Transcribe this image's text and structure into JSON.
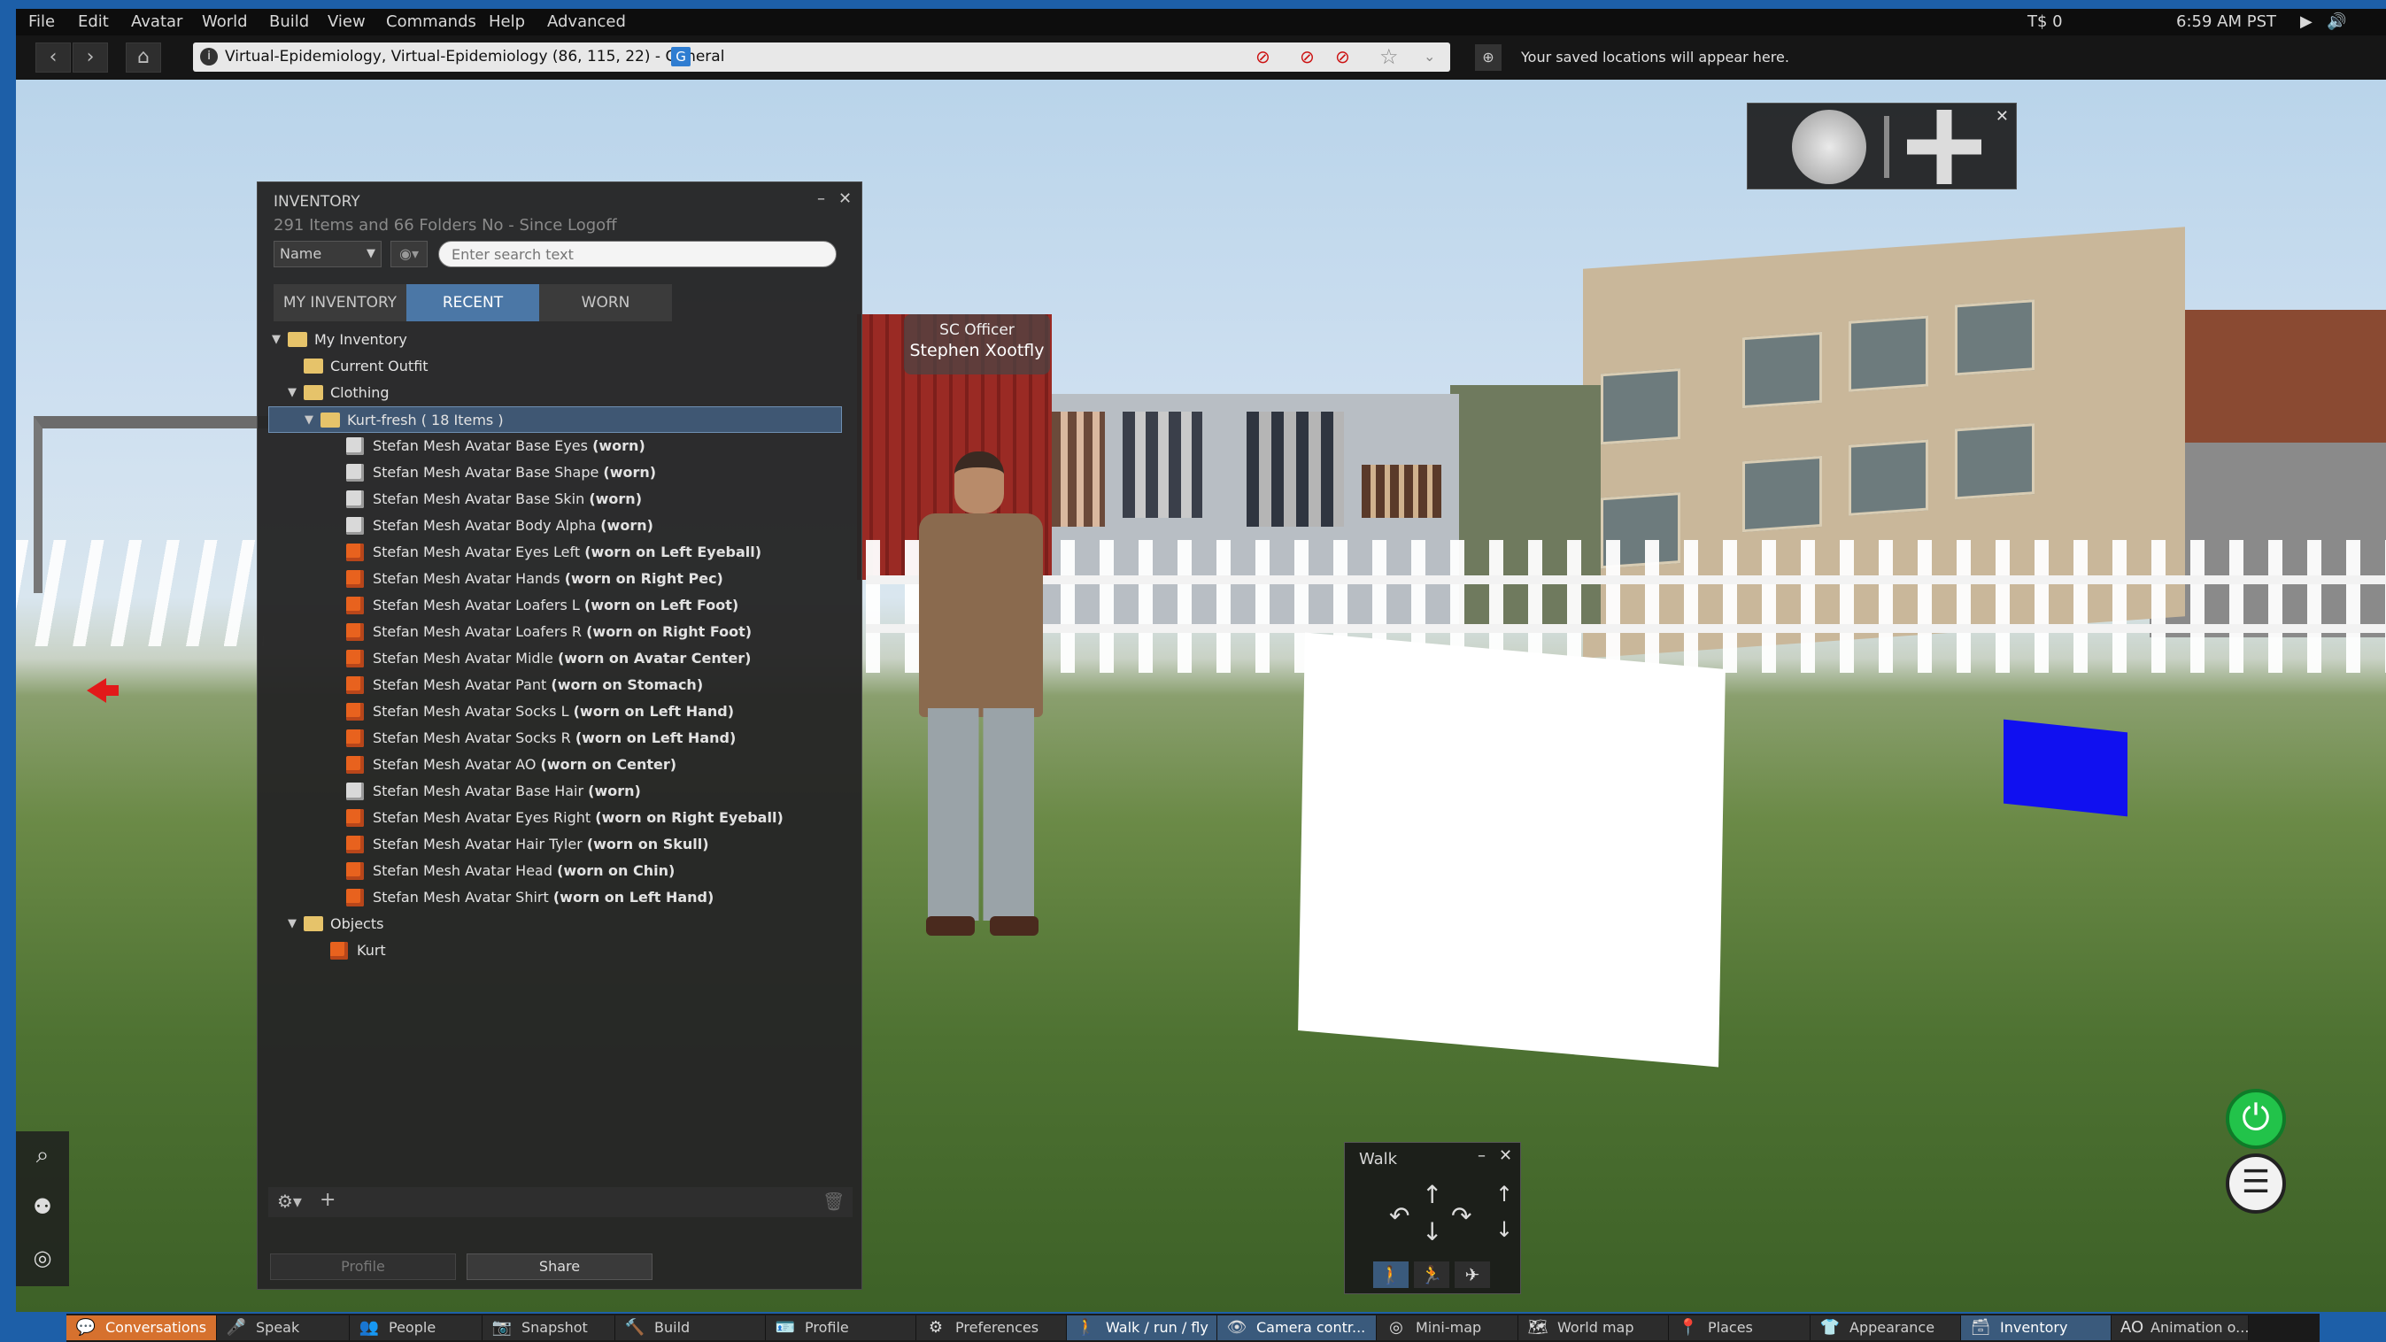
{
  "menu": {
    "items": [
      "File",
      "Edit",
      "Avatar",
      "World",
      "Build",
      "View",
      "Commands",
      "Help",
      "Advanced"
    ],
    "balance": "T$ 0",
    "time": "6:59 AM PST"
  },
  "navbar": {
    "location": "Virtual-Epidemiology, Virtual-Epidemiology (86, 115, 22) - General",
    "maturity_badge": "G",
    "favorites_hint": "Your saved locations will appear here."
  },
  "nametag": {
    "group": "SC Officer",
    "name": "Stephen Xootfly"
  },
  "inventory": {
    "title": "INVENTORY",
    "summary": "291 Items and 66 Folders No  - Since Logoff",
    "sort_select": "Name",
    "search_placeholder": "Enter search text",
    "tabs": [
      "MY INVENTORY",
      "RECENT",
      "WORN"
    ],
    "active_tab": "RECENT",
    "tree": [
      {
        "label": "My Inventory",
        "kind": "folder-open",
        "depth": 0
      },
      {
        "label": "Current Outfit",
        "kind": "folder",
        "depth": 1
      },
      {
        "label": "Clothing",
        "kind": "folder-open",
        "depth": 1
      },
      {
        "label": "Kurt-fresh ( 18 Items )",
        "kind": "folder-open",
        "depth": 2,
        "selected": true
      },
      {
        "label": "Stefan Mesh Avatar Base Eyes",
        "suffix": "(worn)",
        "kind": "eyes",
        "depth": 3
      },
      {
        "label": "Stefan Mesh Avatar Base Shape",
        "suffix": "(worn)",
        "kind": "shape",
        "depth": 3
      },
      {
        "label": "Stefan Mesh Avatar Base Skin",
        "suffix": "(worn)",
        "kind": "skin",
        "depth": 3
      },
      {
        "label": "Stefan Mesh Avatar Body Alpha",
        "suffix": "(worn)",
        "kind": "alpha",
        "depth": 3
      },
      {
        "label": "Stefan Mesh Avatar Eyes Left",
        "suffix": "(worn on Left Eyeball)",
        "kind": "object",
        "depth": 3
      },
      {
        "label": "Stefan Mesh Avatar Hands",
        "suffix": "(worn on Right Pec)",
        "kind": "object",
        "depth": 3
      },
      {
        "label": "Stefan Mesh Avatar Loafers L",
        "suffix": "(worn on Left Foot)",
        "kind": "object",
        "depth": 3
      },
      {
        "label": "Stefan Mesh Avatar Loafers R",
        "suffix": "(worn on Right Foot)",
        "kind": "object",
        "depth": 3
      },
      {
        "label": "Stefan Mesh Avatar Midle",
        "suffix": "(worn on Avatar Center)",
        "kind": "object",
        "depth": 3
      },
      {
        "label": "Stefan Mesh Avatar Pant",
        "suffix": "(worn on Stomach)",
        "kind": "object",
        "depth": 3
      },
      {
        "label": "Stefan Mesh Avatar Socks L",
        "suffix": "(worn on Left Hand)",
        "kind": "object",
        "depth": 3
      },
      {
        "label": "Stefan Mesh Avatar Socks R",
        "suffix": "(worn on Left Hand)",
        "kind": "object",
        "depth": 3
      },
      {
        "label": "Stefan Mesh Avatar AO",
        "suffix": "(worn on Center)",
        "kind": "object",
        "depth": 3
      },
      {
        "label": "Stefan Mesh Avatar Base Hair",
        "suffix": "(worn)",
        "kind": "hair",
        "depth": 3
      },
      {
        "label": "Stefan Mesh Avatar Eyes Right",
        "suffix": "(worn on Right Eyeball)",
        "kind": "object",
        "depth": 3
      },
      {
        "label": "Stefan Mesh Avatar Hair Tyler",
        "suffix": "(worn on Skull)",
        "kind": "object",
        "depth": 3
      },
      {
        "label": "Stefan Mesh Avatar Head",
        "suffix": "(worn on Chin)",
        "kind": "object",
        "depth": 3
      },
      {
        "label": "Stefan Mesh Avatar Shirt",
        "suffix": "(worn on Left Hand)",
        "kind": "object",
        "depth": 3
      },
      {
        "label": "Objects",
        "kind": "folder-open",
        "depth": 1
      },
      {
        "label": "Kurt",
        "kind": "object",
        "depth": 2
      }
    ],
    "profile_button": "Profile",
    "share_button": "Share"
  },
  "walk_panel": {
    "title": "Walk"
  },
  "bottombar": {
    "buttons": [
      {
        "label": "Conversations",
        "icon": "speech-bubble-icon",
        "state": "highlight"
      },
      {
        "label": "Speak",
        "icon": "microphone-icon",
        "state": "normal"
      },
      {
        "label": "People",
        "icon": "people-icon",
        "state": "normal"
      },
      {
        "label": "Snapshot",
        "icon": "camera-icon",
        "state": "normal"
      },
      {
        "label": "Build",
        "icon": "hammer-icon",
        "state": "normal"
      },
      {
        "label": "Profile",
        "icon": "profile-card-icon",
        "state": "normal"
      },
      {
        "label": "Preferences",
        "icon": "gear-icon",
        "state": "normal"
      },
      {
        "label": "Walk / run / fly",
        "icon": "walking-icon",
        "state": "active"
      },
      {
        "label": "Camera contr...",
        "icon": "eye-icon",
        "state": "active"
      },
      {
        "label": "Mini-map",
        "icon": "radar-icon",
        "state": "normal"
      },
      {
        "label": "World map",
        "icon": "map-icon",
        "state": "normal"
      },
      {
        "label": "Places",
        "icon": "pin-icon",
        "state": "normal"
      },
      {
        "label": "Appearance",
        "icon": "shirt-icon",
        "state": "normal"
      },
      {
        "label": "Inventory",
        "icon": "inventory-icon",
        "state": "active"
      },
      {
        "label": "Animation o...",
        "icon": "ao-icon",
        "state": "normal"
      }
    ]
  },
  "colors": {
    "accent_blue": "#3f5773",
    "conversation_orange": "#d6712e",
    "power_green": "#22c34a",
    "cube_blue": "#1010f0"
  }
}
